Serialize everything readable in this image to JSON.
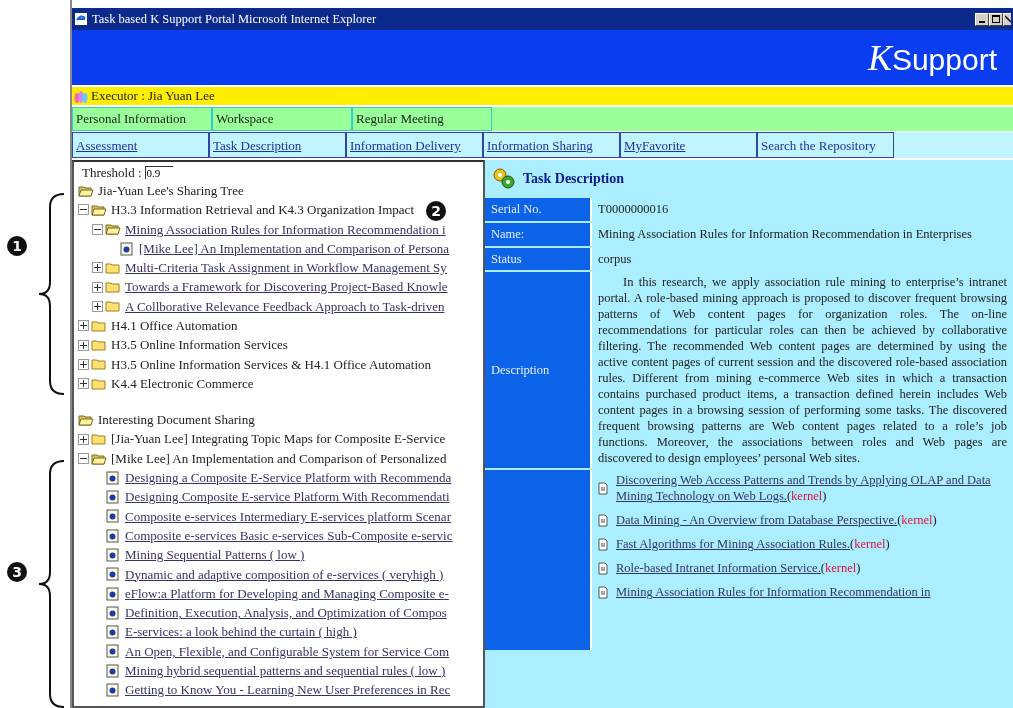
{
  "window": {
    "title": "Task based K Support Portal  Microsoft Internet Explorer"
  },
  "banner": {
    "logo_letter": "K",
    "logo_text": "Support"
  },
  "executor": "Executor : Jia Yuan Lee",
  "nav_primary": [
    {
      "label": "Personal Information"
    },
    {
      "label": "Workspace"
    },
    {
      "label": "Regular Meeting"
    }
  ],
  "nav_secondary": [
    {
      "label": "Assessment",
      "link": true
    },
    {
      "label": "Task Description",
      "link": true
    },
    {
      "label": "Information Delivery",
      "link": true
    },
    {
      "label": "Information Sharing",
      "link": true
    },
    {
      "label": "MyFavorite",
      "link": true
    },
    {
      "label": "Search the Repository",
      "link": false
    }
  ],
  "threshold": {
    "label": "Threshold :",
    "value": "0.9"
  },
  "trees": [
    {
      "label": "Jia-Yuan Lee's Sharing Tree",
      "children": [
        {
          "label": "H3.3 Information Retrieval and K4.3 Organization Impact",
          "kind": "folder",
          "expanded": true,
          "link": false,
          "children": [
            {
              "label": "Mining Association Rules for Information Recommendation i",
              "kind": "folder",
              "expanded": true,
              "link": true,
              "children": [
                {
                  "label": "[Mike Lee] An Implementation and Comparison of Persona",
                  "kind": "document",
                  "link": true
                }
              ]
            },
            {
              "label": "Multi-Criteria Task Assignment in Workflow Management Sy",
              "kind": "folder",
              "expanded": false,
              "link": true
            },
            {
              "label": "Towards a Framework for Discovering Project-Based Knowle",
              "kind": "folder",
              "expanded": false,
              "link": true
            },
            {
              "label": "A Collborative Relevance Feedback Approach to Task-driven",
              "kind": "folder",
              "expanded": false,
              "link": true
            }
          ]
        },
        {
          "label": "H4.1 Office Automation",
          "kind": "folder",
          "expanded": false,
          "link": false
        },
        {
          "label": "H3.5 Online Information Services",
          "kind": "folder",
          "expanded": false,
          "link": false
        },
        {
          "label": "H3.5 Online Information Services & H4.1 Office Automation",
          "kind": "folder",
          "expanded": false,
          "link": false
        },
        {
          "label": "K4.4 Electronic Commerce",
          "kind": "folder",
          "expanded": false,
          "link": false
        }
      ]
    },
    {
      "label": "Interesting Document Sharing",
      "children": [
        {
          "label": "[Jia-Yuan Lee] Integrating Topic Maps for Composite E-Service",
          "kind": "folder",
          "expanded": false,
          "link": false
        },
        {
          "label": "[Mike Lee] An Implementation and Comparison of Personalized",
          "kind": "folder",
          "expanded": true,
          "link": false,
          "children": [
            {
              "label": "Designing a Composite E-Service Platform with Recommenda",
              "kind": "document",
              "link": true
            },
            {
              "label": "Designing Composite E-service Platform With Recommendati",
              "kind": "document",
              "link": true
            },
            {
              "label": "Composite e-services Intermediary E-services platform Scenar",
              "kind": "document",
              "link": true
            },
            {
              "label": "Composite e-services Basic e-services Sub-Composite e-servic",
              "kind": "document",
              "link": true
            },
            {
              "label": "Mining Sequential Patterns ( low )",
              "kind": "document",
              "link": true
            },
            {
              "label": "Dynamic and adaptive composition of e-services ( veryhigh )",
              "kind": "document",
              "link": true
            },
            {
              "label": "eFlow:a Platform for Developing and Managing Composite e-",
              "kind": "document",
              "link": true
            },
            {
              "label": "Definition, Execution, Analysis, and Optimization of Compos",
              "kind": "document",
              "link": true
            },
            {
              "label": "E-services: a look behind the curtain ( high )",
              "kind": "document",
              "link": true
            },
            {
              "label": "An Open, Flexible, and Configurable System for Service Com",
              "kind": "document",
              "link": true
            },
            {
              "label": "Mining hybrid sequential patterns and sequential rules ( low )",
              "kind": "document",
              "link": true
            },
            {
              "label": "Getting to Know You - Learning New User Preferences in Rec",
              "kind": "document",
              "link": true
            }
          ]
        }
      ]
    }
  ],
  "task": {
    "heading": "Task Description",
    "fields": [
      {
        "label": "Serial No.",
        "value": "T0000000016"
      },
      {
        "label": "Name:",
        "value": "Mining Association Rules for Information Recommendation in Enterprises"
      },
      {
        "label": "Status",
        "value": "corpus"
      }
    ],
    "description": {
      "label": "Description",
      "text": "In this research, we apply association rule mining to enterprise’s intranet portal. A role-based mining approach is proposed to discover frequent browsing patterns of Web content pages for organization roles. The on-line recommendations for particular roles can then be achieved by collaborative filtering. The recommended Web content pages are determined by using the active content pages of current session and the discovered role-based association rules. Different from mining e-commerce Web sites in which a transaction contains purchased product items, a transaction defined herein includes Web content pages in a browsing session of performing some tasks. The discovered frequent browsing patterns are Web content pages related to a role’s job functions. Moreover, the associations between roles and Web pages are discovered to design employees’ personal Web sites."
    },
    "references": [
      {
        "title": "Discovering Web Access Patterns and Trends by Applying OLAP and Data Mining Technology on Web Logs.",
        "tag": "(kernel)"
      },
      {
        "title": "Data Mining - An Overview from Database Perspective.",
        "tag": "(kernel)"
      },
      {
        "title": "Fast Algorithms for Mining Association Rules.",
        "tag": "(kernel)"
      },
      {
        "title": "Role-based Intranet Information Service.",
        "tag": "(kernel)"
      },
      {
        "title": "Mining Association Rules for Information Recommendation in"
      }
    ]
  },
  "callouts": [
    {
      "label": "1"
    },
    {
      "label": "2"
    },
    {
      "label": "3"
    }
  ]
}
